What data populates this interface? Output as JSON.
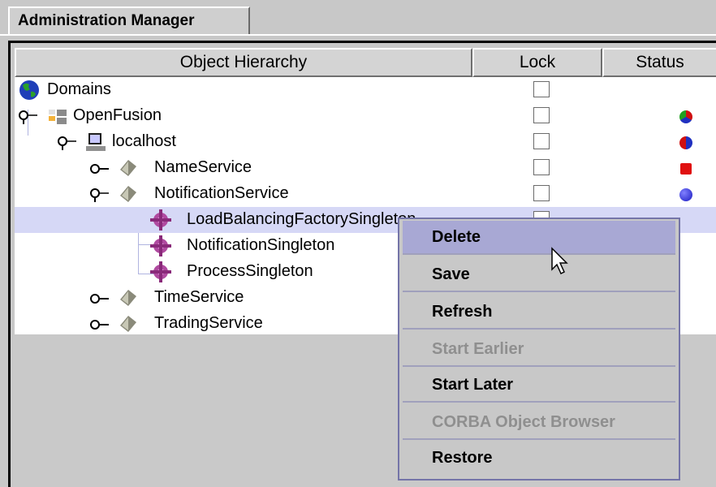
{
  "tab": {
    "label": "Administration Manager"
  },
  "columns": [
    "Object Hierarchy",
    "Lock",
    "Status"
  ],
  "tree": [
    {
      "label": "Domains",
      "icon": "globe-icon",
      "status": null
    },
    {
      "label": "OpenFusion",
      "icon": "network-icon",
      "status": "multicolor-ball"
    },
    {
      "label": "localhost",
      "icon": "computer-icon",
      "status": "red-blue-ball"
    },
    {
      "label": "NameService",
      "icon": "service-icon",
      "status": "red-square"
    },
    {
      "label": "NotificationService",
      "icon": "service-icon",
      "status": "blue-ball"
    },
    {
      "label": "LoadBalancingFactorySingleton",
      "icon": "component-icon",
      "status": null
    },
    {
      "label": "NotificationSingleton",
      "icon": "component-icon",
      "status": null
    },
    {
      "label": "ProcessSingleton",
      "icon": "component-icon",
      "status": null
    },
    {
      "label": "TimeService",
      "icon": "service-icon",
      "status": null
    },
    {
      "label": "TradingService",
      "icon": "service-icon",
      "status": null
    }
  ],
  "menu": [
    {
      "label": "Delete",
      "enabled": true,
      "highlighted": true
    },
    {
      "label": "Save",
      "enabled": true
    },
    {
      "label": "Refresh",
      "enabled": true
    },
    {
      "label": "Start Earlier",
      "enabled": false
    },
    {
      "label": "Start Later",
      "enabled": true
    },
    {
      "label": "CORBA Object Browser",
      "enabled": false
    },
    {
      "label": "Restore",
      "enabled": true
    }
  ],
  "colors": {
    "selection": "#d6d8f6",
    "menu_highlight": "#a8a8d4",
    "disabled_text": "#8f8f8f"
  }
}
